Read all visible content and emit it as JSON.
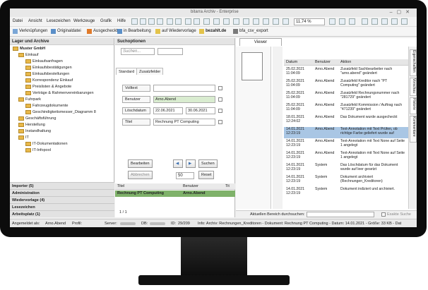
{
  "window": {
    "title": "bitarra Archiv - Enterprise"
  },
  "menu": [
    "Datei",
    "Ansicht",
    "Lesezeichen",
    "Werkzeuge",
    "Grafik",
    "Hilfe"
  ],
  "toolbar": {
    "zoom": "11,74 %"
  },
  "actions": [
    "Verknüpfungen",
    "Originaldatei",
    "Ausgecheckt",
    "in Bearbeitung",
    "auf Wiedervorlage",
    "bezahlt.de",
    "bfa_csv_export"
  ],
  "left": {
    "header": "Lager und Archive",
    "tree": [
      {
        "label": "Muster GmbH",
        "bold": true
      },
      {
        "label": "Einkauf"
      },
      {
        "label": "Einkaufsanfragen"
      },
      {
        "label": "Einkaufsbestätigungen"
      },
      {
        "label": "Einkaufsbestellungen"
      },
      {
        "label": "Korrespondenz Einkauf"
      },
      {
        "label": "Preislisten & Angebote"
      },
      {
        "label": "Verträge & Rahmenvereinbarungen"
      },
      {
        "label": "Fuhrpark"
      },
      {
        "label": "Fahrzeugdokumente"
      },
      {
        "label": "Geschindigkeitsmesser_Diagramm 8"
      },
      {
        "label": "Geschäftsführung"
      },
      {
        "label": "Herstellung"
      },
      {
        "label": "Instandhaltung"
      },
      {
        "label": "IT"
      },
      {
        "label": "IT-Dokumentationen"
      },
      {
        "label": "IT-Infopool"
      }
    ],
    "sections": [
      "Importer (5)",
      "Administration",
      "Wiedervorlage (4)",
      "Lesezeichen",
      "Arbeitsplatz (1)"
    ]
  },
  "search": {
    "header": "Suchoptionen",
    "placeholder": "Suchen...",
    "tabs": [
      "Standard",
      "Zusatzfelder"
    ],
    "fields": [
      {
        "label": "Volltext",
        "value": ""
      },
      {
        "label": "Benutzer",
        "value": "Arno.Abend"
      },
      {
        "label": "Löschdatum",
        "value": "22.06.2021",
        "value2": "30.06.2021"
      },
      {
        "label": "Titel",
        "value": "Rechnung PT Computing"
      }
    ],
    "buttons": {
      "edit": "Bearbeiten",
      "cancel": "Abbrechen",
      "search": "Suchen",
      "reset": "Reset",
      "count": "50"
    },
    "results_header": [
      "Titel",
      "Benutzer",
      "Tit"
    ],
    "results": [
      {
        "title": "Rechnung PT Computing",
        "user": "Arno.Abend"
      }
    ],
    "pager": "1 / 1"
  },
  "viewer": {
    "tab": "Viewer",
    "history_header": [
      "Datum",
      "Benutzer",
      "Aktion"
    ],
    "history": [
      {
        "date": "25.02.2021 11:04:09",
        "user": "Arno.Abend",
        "action": "Zusatzfeld Sachbearbeiter nach \"arno.abend\" geändert"
      },
      {
        "date": "25.02.2021 11:04:09",
        "user": "Arno.Abend",
        "action": "Zusatzfeld Kreditor nach \"PT Computing\" geändert"
      },
      {
        "date": "25.02.2021 11:04:09",
        "user": "Arno.Abend",
        "action": "Zusatzfeld Rechnungsnummer nach \"281729\" geändert"
      },
      {
        "date": "25.02.2021 11:04:09",
        "user": "Arno.Abend",
        "action": "Zusatzfeld Kommission / Auftrag nach \"471239\" geändert"
      },
      {
        "date": "18.01.2021 12:24:02",
        "user": "Arno.Abend",
        "action": "Das Dokument wurde ausgecheckt"
      },
      {
        "date": "14.01.2021 12:23:19",
        "user": "Arno.Abend",
        "action": "Text-Annotation mit Text Prüfen, ob richtige Farbe geliefert wurde auf",
        "selected": true
      },
      {
        "date": "14.01.2021 12:23:19",
        "user": "Arno.Abend",
        "action": "Text-Annotation mit Text None auf Seite 1 angelegt"
      },
      {
        "date": "14.01.2021 12:23:19",
        "user": "Arno.Abend",
        "action": "Text-Annotation mit Text None auf Seite 1 angelegt"
      },
      {
        "date": "14.01.2021 12:23:19",
        "user": "System",
        "action": "Das Löschdatum für das Dokument wurde auf leer gesetzt"
      },
      {
        "date": "14.01.2021 12:23:19",
        "user": "System",
        "action": "Dokument archiviert (Rechnungen_Kreditoren)"
      },
      {
        "date": "14.01.2021 12:23:19",
        "user": "System",
        "action": "Dokument indiziert und archiviert."
      }
    ],
    "vtabs": [
      "Eigenschaften",
      "Vorschau",
      "Historie",
      "Kommentare"
    ],
    "find_label": "Aktuellen Bereich durchsuchen:",
    "find_option": "Exakte Suche"
  },
  "status": {
    "logged_in_label": "Angemeldet als:",
    "logged_in_user": "Arno.Abend",
    "profile_label": "Profil:",
    "server_label": "Server:",
    "db_label": "DB:",
    "id_label": "ID:",
    "id_value": "29/209",
    "info": "Info: Archiv: Rechnungen_Kreditoren - Dokument: Rechnung PT Computing - Datum: 14.01.2021 - Größe: 33 KB - Dat"
  },
  "colors": {
    "result_row": "#7fb26a",
    "selected_row": "#a9c6e4",
    "folder": "#e8b84a",
    "bezel": "#0c0c0c"
  }
}
